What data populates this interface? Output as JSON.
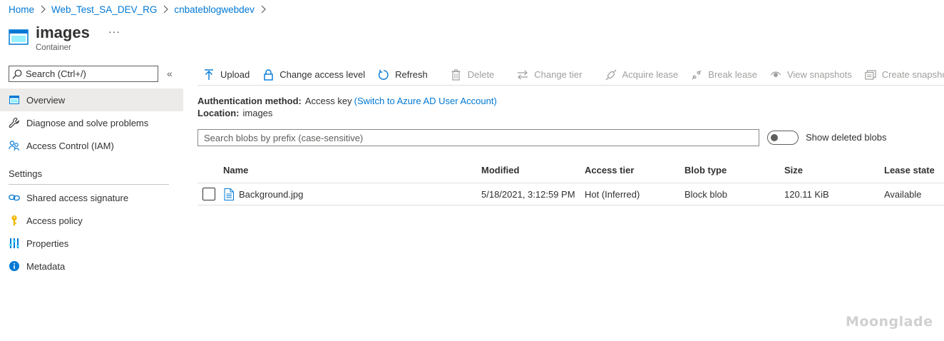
{
  "breadcrumb": [
    {
      "label": "Home"
    },
    {
      "label": "Web_Test_SA_DEV_RG"
    },
    {
      "label": "cnbateblogwebdev"
    }
  ],
  "page": {
    "title": "images",
    "subtitle": "Container",
    "more": "···"
  },
  "sidebar": {
    "search_placeholder": "Search (Ctrl+/)",
    "collapse": "«",
    "items": [
      {
        "label": "Overview",
        "icon": "container-icon",
        "active": true
      },
      {
        "label": "Diagnose and solve problems",
        "icon": "wrench-icon"
      },
      {
        "label": "Access Control (IAM)",
        "icon": "people-icon"
      }
    ],
    "settings_title": "Settings",
    "settings_items": [
      {
        "label": "Shared access signature",
        "icon": "link-icon"
      },
      {
        "label": "Access policy",
        "icon": "key-icon"
      },
      {
        "label": "Properties",
        "icon": "properties-icon"
      },
      {
        "label": "Metadata",
        "icon": "info-icon"
      }
    ]
  },
  "toolbar": {
    "upload": "Upload",
    "change_access_level": "Change access level",
    "refresh": "Refresh",
    "delete": "Delete",
    "change_tier": "Change tier",
    "acquire_lease": "Acquire lease",
    "break_lease": "Break lease",
    "view_snapshots": "View snapshots",
    "create_snapshot": "Create snapshot"
  },
  "info": {
    "auth_label": "Authentication method:",
    "auth_value": "Access key",
    "auth_link": "(Switch to Azure AD User Account)",
    "location_label": "Location:",
    "location_value": "images"
  },
  "blob_search": {
    "placeholder": "Search blobs by prefix (case-sensitive)"
  },
  "show_deleted": {
    "label": "Show deleted blobs",
    "on": false
  },
  "table": {
    "columns": [
      "Name",
      "Modified",
      "Access tier",
      "Blob type",
      "Size",
      "Lease state"
    ],
    "rows": [
      {
        "name": "Background.jpg",
        "modified": "5/18/2021, 3:12:59 PM",
        "access_tier": "Hot (Inferred)",
        "blob_type": "Block blob",
        "size": "120.11 KiB",
        "lease_state": "Available"
      }
    ]
  },
  "watermark": "Moonglade",
  "colors": {
    "link": "#0078d4",
    "text": "#323130",
    "disabled": "#a19f9d",
    "active_bg": "#edebe9",
    "icon_blue": "#0078d4",
    "key_yellow": "#f2b600"
  }
}
